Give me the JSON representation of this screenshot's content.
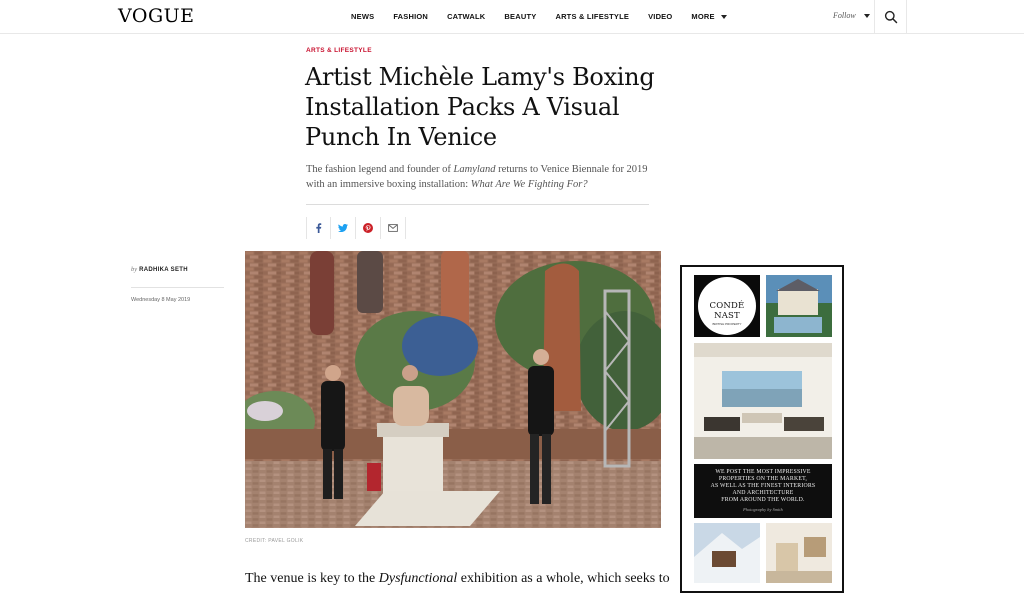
{
  "header": {
    "logo": "VOGUE",
    "nav": [
      "NEWS",
      "FASHION",
      "CATWALK",
      "BEAUTY",
      "ARTS & LIFESTYLE",
      "VIDEO",
      "MORE"
    ],
    "follow_label": "Follow",
    "search_icon": "search-icon"
  },
  "article": {
    "kicker": "ARTS & LIFESTYLE",
    "headline": "Artist Michèle Lamy's Boxing Installation Packs A Visual Punch In Venice",
    "dek_part1": "The fashion legend and founder of ",
    "dek_em1": "Lamyland",
    "dek_part2": " returns to Venice Biennale for 2019 with an immersive boxing installation: ",
    "dek_em2": "What Are We Fighting For?",
    "share_icons": [
      "facebook-icon",
      "twitter-icon",
      "pinterest-icon",
      "email-icon"
    ],
    "byline_prefix": "by",
    "author": "RADHIKA SETH",
    "date": "Wednesday 8 May 2019",
    "photo_credit": "CREDIT: PAVEL GOLIK",
    "body_part1": "The venue is key to the ",
    "body_em": "Dysfunctional",
    "body_part2": " exhibition as a whole, which seeks to"
  },
  "ad": {
    "brand_line1": "CONDÉ NAST",
    "brand_line2": "BRITISH PROPERTY",
    "text_lines": [
      "WE POST THE MOST IMPRESSIVE",
      "PROPERTIES ON THE MARKET,",
      "AS WELL AS THE FINEST INTERIORS",
      "AND ARCHITECTURE",
      "FROM AROUND THE WORLD."
    ],
    "photo_credit": "Photography by  Smith"
  },
  "colors": {
    "kicker_red": "#c8102e",
    "pinterest_red": "#cb2027",
    "facebook_blue": "#3b5998",
    "twitter_blue": "#1da1f2"
  }
}
